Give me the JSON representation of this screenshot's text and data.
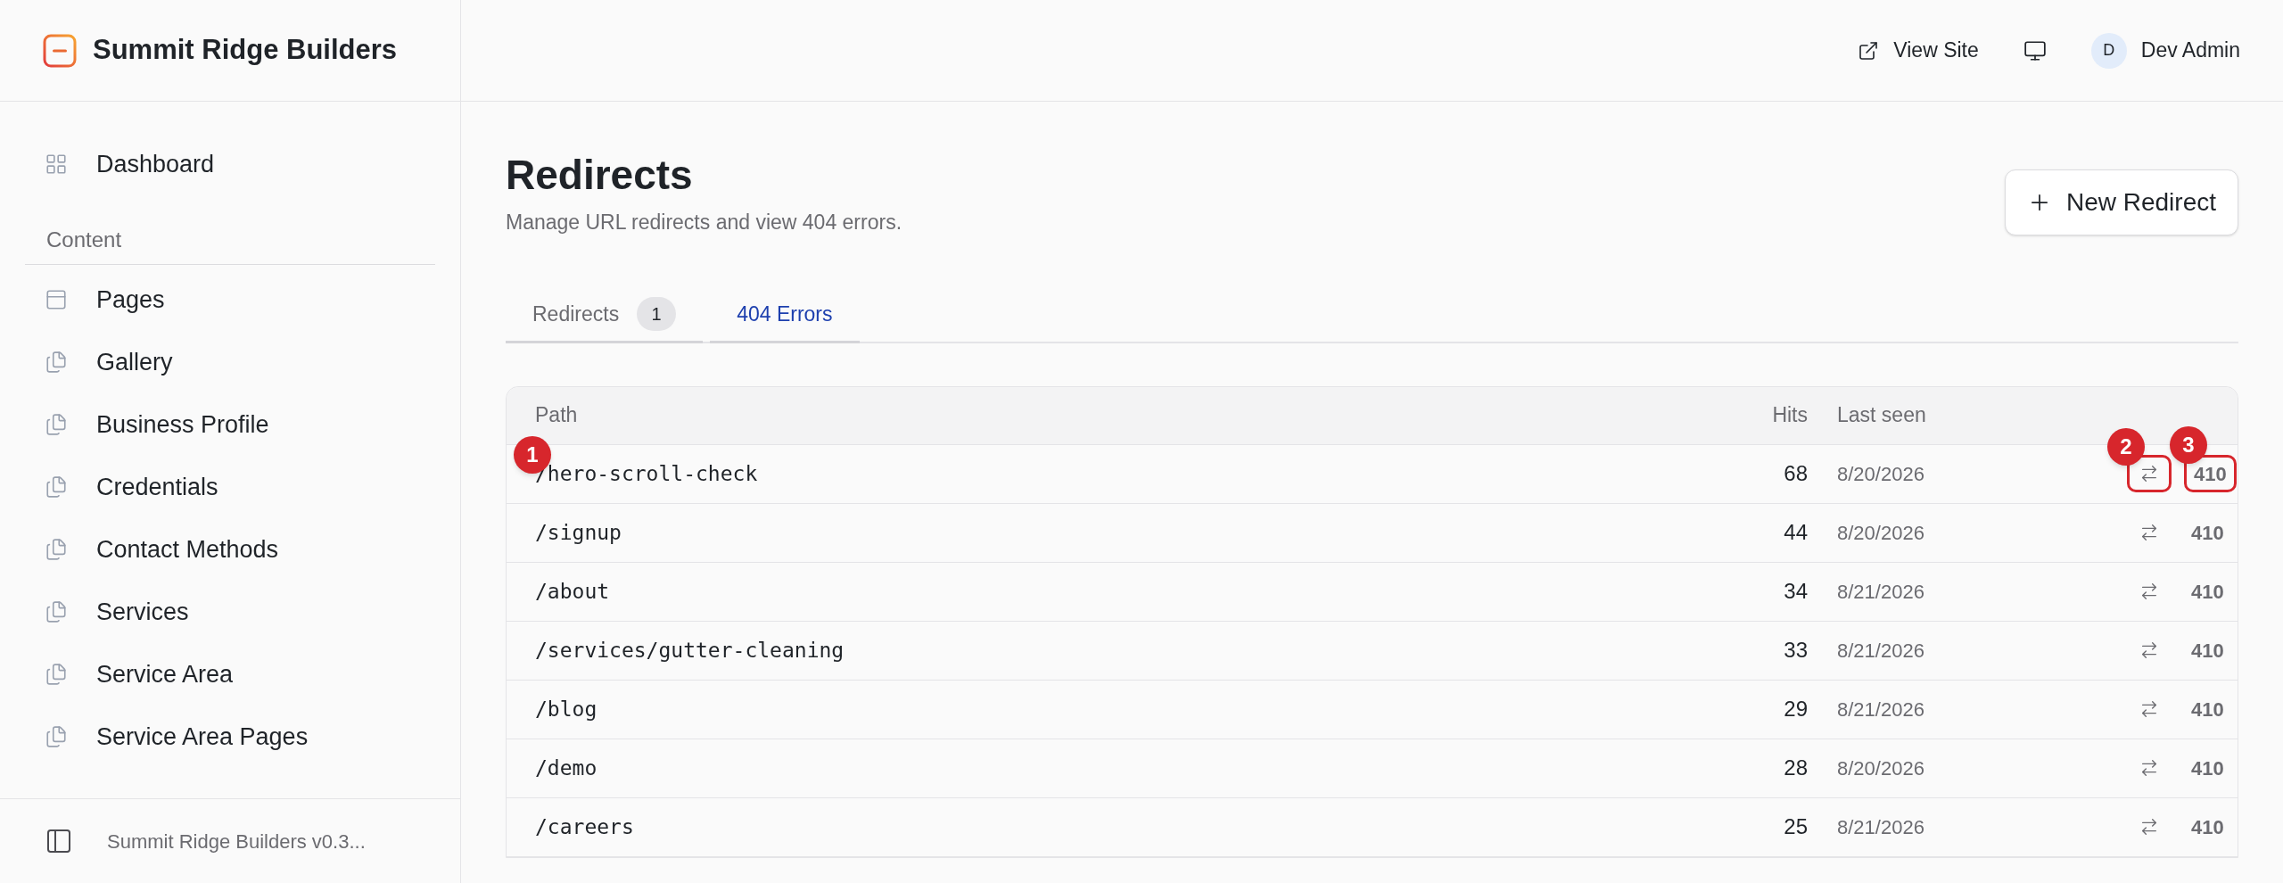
{
  "brand": {
    "name": "Summit Ridge Builders"
  },
  "header": {
    "view_site": "View Site",
    "user": {
      "initial": "D",
      "name": "Dev Admin"
    }
  },
  "sidebar": {
    "items": [
      {
        "label": "Dashboard",
        "kind": "grid"
      }
    ],
    "sections": [
      {
        "title": "Content",
        "items": [
          {
            "label": "Pages",
            "kind": "panel"
          },
          {
            "label": "Gallery",
            "kind": "files"
          },
          {
            "label": "Business Profile",
            "kind": "files"
          },
          {
            "label": "Credentials",
            "kind": "files"
          },
          {
            "label": "Contact Methods",
            "kind": "files"
          },
          {
            "label": "Services",
            "kind": "files"
          },
          {
            "label": "Service Area",
            "kind": "files"
          },
          {
            "label": "Service Area Pages",
            "kind": "files"
          }
        ]
      }
    ],
    "footer": "Summit Ridge Builders v0.3..."
  },
  "page": {
    "title": "Redirects",
    "subtitle": "Manage URL redirects and view 404 errors.",
    "new_button": "New Redirect"
  },
  "tabs": [
    {
      "label": "Redirects",
      "count": "1",
      "selected": false
    },
    {
      "label": "404 Errors",
      "selected": true
    }
  ],
  "table": {
    "columns": [
      "Path",
      "Hits",
      "Last seen"
    ],
    "rows": [
      {
        "path": "/hero-scroll-check",
        "hits": "68",
        "last_seen": "8/20/2026",
        "status": "410",
        "path_marker": "1",
        "redirect_marker": "2",
        "status_marker": "3"
      },
      {
        "path": "/signup",
        "hits": "44",
        "last_seen": "8/20/2026",
        "status": "410"
      },
      {
        "path": "/about",
        "hits": "34",
        "last_seen": "8/21/2026",
        "status": "410"
      },
      {
        "path": "/services/gutter-cleaning",
        "hits": "33",
        "last_seen": "8/21/2026",
        "status": "410"
      },
      {
        "path": "/blog",
        "hits": "29",
        "last_seen": "8/21/2026",
        "status": "410"
      },
      {
        "path": "/demo",
        "hits": "28",
        "last_seen": "8/20/2026",
        "status": "410"
      },
      {
        "path": "/careers",
        "hits": "25",
        "last_seen": "8/21/2026",
        "status": "410"
      }
    ]
  }
}
